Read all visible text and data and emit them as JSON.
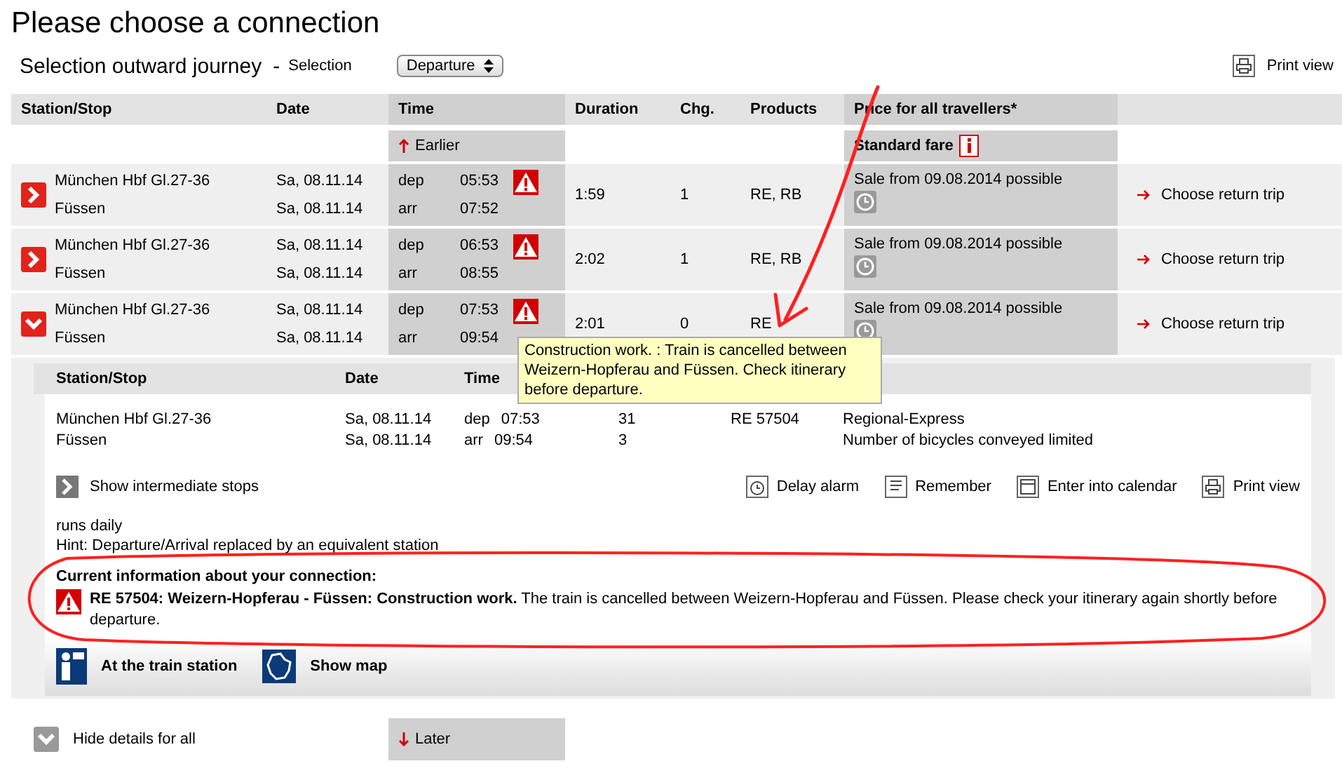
{
  "title": "Please choose a connection",
  "subtitle": "Selection outward journey",
  "separator": "-",
  "selection_label": "Selection",
  "selection": {
    "value": "Departure"
  },
  "print_view": "Print view",
  "columns": [
    "Station/Stop",
    "Date",
    "Time",
    "Duration",
    "Chg.",
    "Products",
    "Price for all travellers*"
  ],
  "earlier": "Earlier",
  "standard_fare": "Standard fare",
  "connections": [
    {
      "expanded": false,
      "warning": true,
      "stops": [
        {
          "station": "München Hbf Gl.27-36",
          "date": "Sa, 08.11.14",
          "type": "dep",
          "time": "05:53"
        },
        {
          "station": "Füssen",
          "date": "Sa, 08.11.14",
          "type": "arr",
          "time": "07:52"
        }
      ],
      "duration": "1:59",
      "changes": "1",
      "products": "RE, RB",
      "price_note": "Sale from 09.08.2014 possible",
      "return_link": "Choose return trip"
    },
    {
      "expanded": false,
      "warning": true,
      "stops": [
        {
          "station": "München Hbf Gl.27-36",
          "date": "Sa, 08.11.14",
          "type": "dep",
          "time": "06:53"
        },
        {
          "station": "Füssen",
          "date": "Sa, 08.11.14",
          "type": "arr",
          "time": "08:55"
        }
      ],
      "duration": "2:02",
      "changes": "1",
      "products": "RE, RB",
      "price_note": "Sale from 09.08.2014 possible",
      "return_link": "Choose return trip"
    },
    {
      "expanded": true,
      "warning": true,
      "stops": [
        {
          "station": "München Hbf Gl.27-36",
          "date": "Sa, 08.11.14",
          "type": "dep",
          "time": "07:53"
        },
        {
          "station": "Füssen",
          "date": "Sa, 08.11.14",
          "type": "arr",
          "time": "09:54"
        }
      ],
      "duration": "2:01",
      "changes": "0",
      "products": "RE",
      "price_note": "Sale from 09.08.2014 possible",
      "return_link": "Choose return trip"
    }
  ],
  "tooltip": "Construction work. : Train is cancelled between Weizern-Hopferau and Füssen. Check itinerary before departure.",
  "details": {
    "columns": [
      "Station/Stop",
      "Date",
      "Time"
    ],
    "rows": [
      {
        "station": "München Hbf Gl.27-36",
        "date": "Sa, 08.11.14",
        "type": "dep",
        "time": "07:53",
        "platform": "31",
        "train": "RE 57504",
        "note": "Regional-Express"
      },
      {
        "station": "Füssen",
        "date": "Sa, 08.11.14",
        "type": "arr",
        "time": "09:54",
        "platform": "3",
        "note": "Number of bicycles conveyed limited"
      }
    ],
    "show_intermediate": "Show intermediate stops",
    "actions": [
      {
        "kind": "alarm",
        "label": "Delay alarm"
      },
      {
        "kind": "remember",
        "label": "Remember"
      },
      {
        "kind": "calendar",
        "label": "Enter into calendar"
      },
      {
        "kind": "print",
        "label": "Print view"
      }
    ],
    "notes": [
      "runs daily",
      "Hint: Departure/Arrival replaced by an equivalent station"
    ],
    "info_heading": "Current information about your connection:",
    "info": "**RE 57504: Weizern-Hopferau - Füssen:  Construction work.**  The train is cancelled between Weizern-Hopferau and Füssen. Please check your itinerary again shortly before departure.",
    "links": [
      {
        "kind": "station",
        "label": "At the train station"
      },
      {
        "kind": "map",
        "label": "Show map"
      }
    ]
  },
  "hide_details": "Hide details for all",
  "later": "Later"
}
